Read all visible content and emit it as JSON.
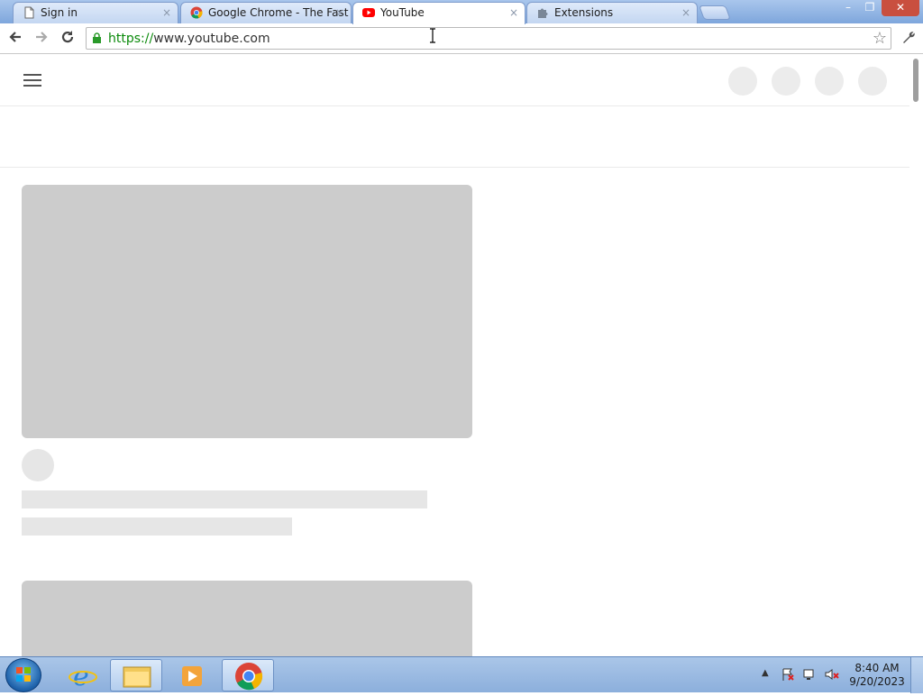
{
  "browser": {
    "tabs": [
      {
        "title": "Sign in",
        "icon": "page-icon",
        "active": false
      },
      {
        "title": "Google Chrome - The Fast",
        "icon": "chrome-icon",
        "active": false
      },
      {
        "title": "YouTube",
        "icon": "youtube-icon",
        "active": true
      },
      {
        "title": "Extensions",
        "icon": "puzzle-icon",
        "active": false
      }
    ],
    "tab_close": "×",
    "window_controls": {
      "minimize": "–",
      "maximize": "❐",
      "close": "✕"
    },
    "address": {
      "scheme": "https://",
      "rest": "www.youtube.com"
    },
    "icons": {
      "back": "back-arrow-icon",
      "forward": "forward-arrow-icon",
      "reload": "reload-icon",
      "bookmark": "star-icon",
      "menu": "wrench-icon"
    }
  },
  "taskbar": {
    "clock_time": "8:40 AM",
    "clock_date": "9/20/2023",
    "pinned": [
      "internet-explorer-icon",
      "windows-explorer-icon",
      "media-player-icon",
      "chrome-icon"
    ],
    "tray_icons": [
      "show-hidden-icons",
      "action-center-flag-icon",
      "network-icon",
      "volume-muted-icon"
    ]
  },
  "colors": {
    "skeleton": "#cccccc",
    "skeleton_light": "#e6e6e6",
    "youtube_red": "#ff0000"
  }
}
